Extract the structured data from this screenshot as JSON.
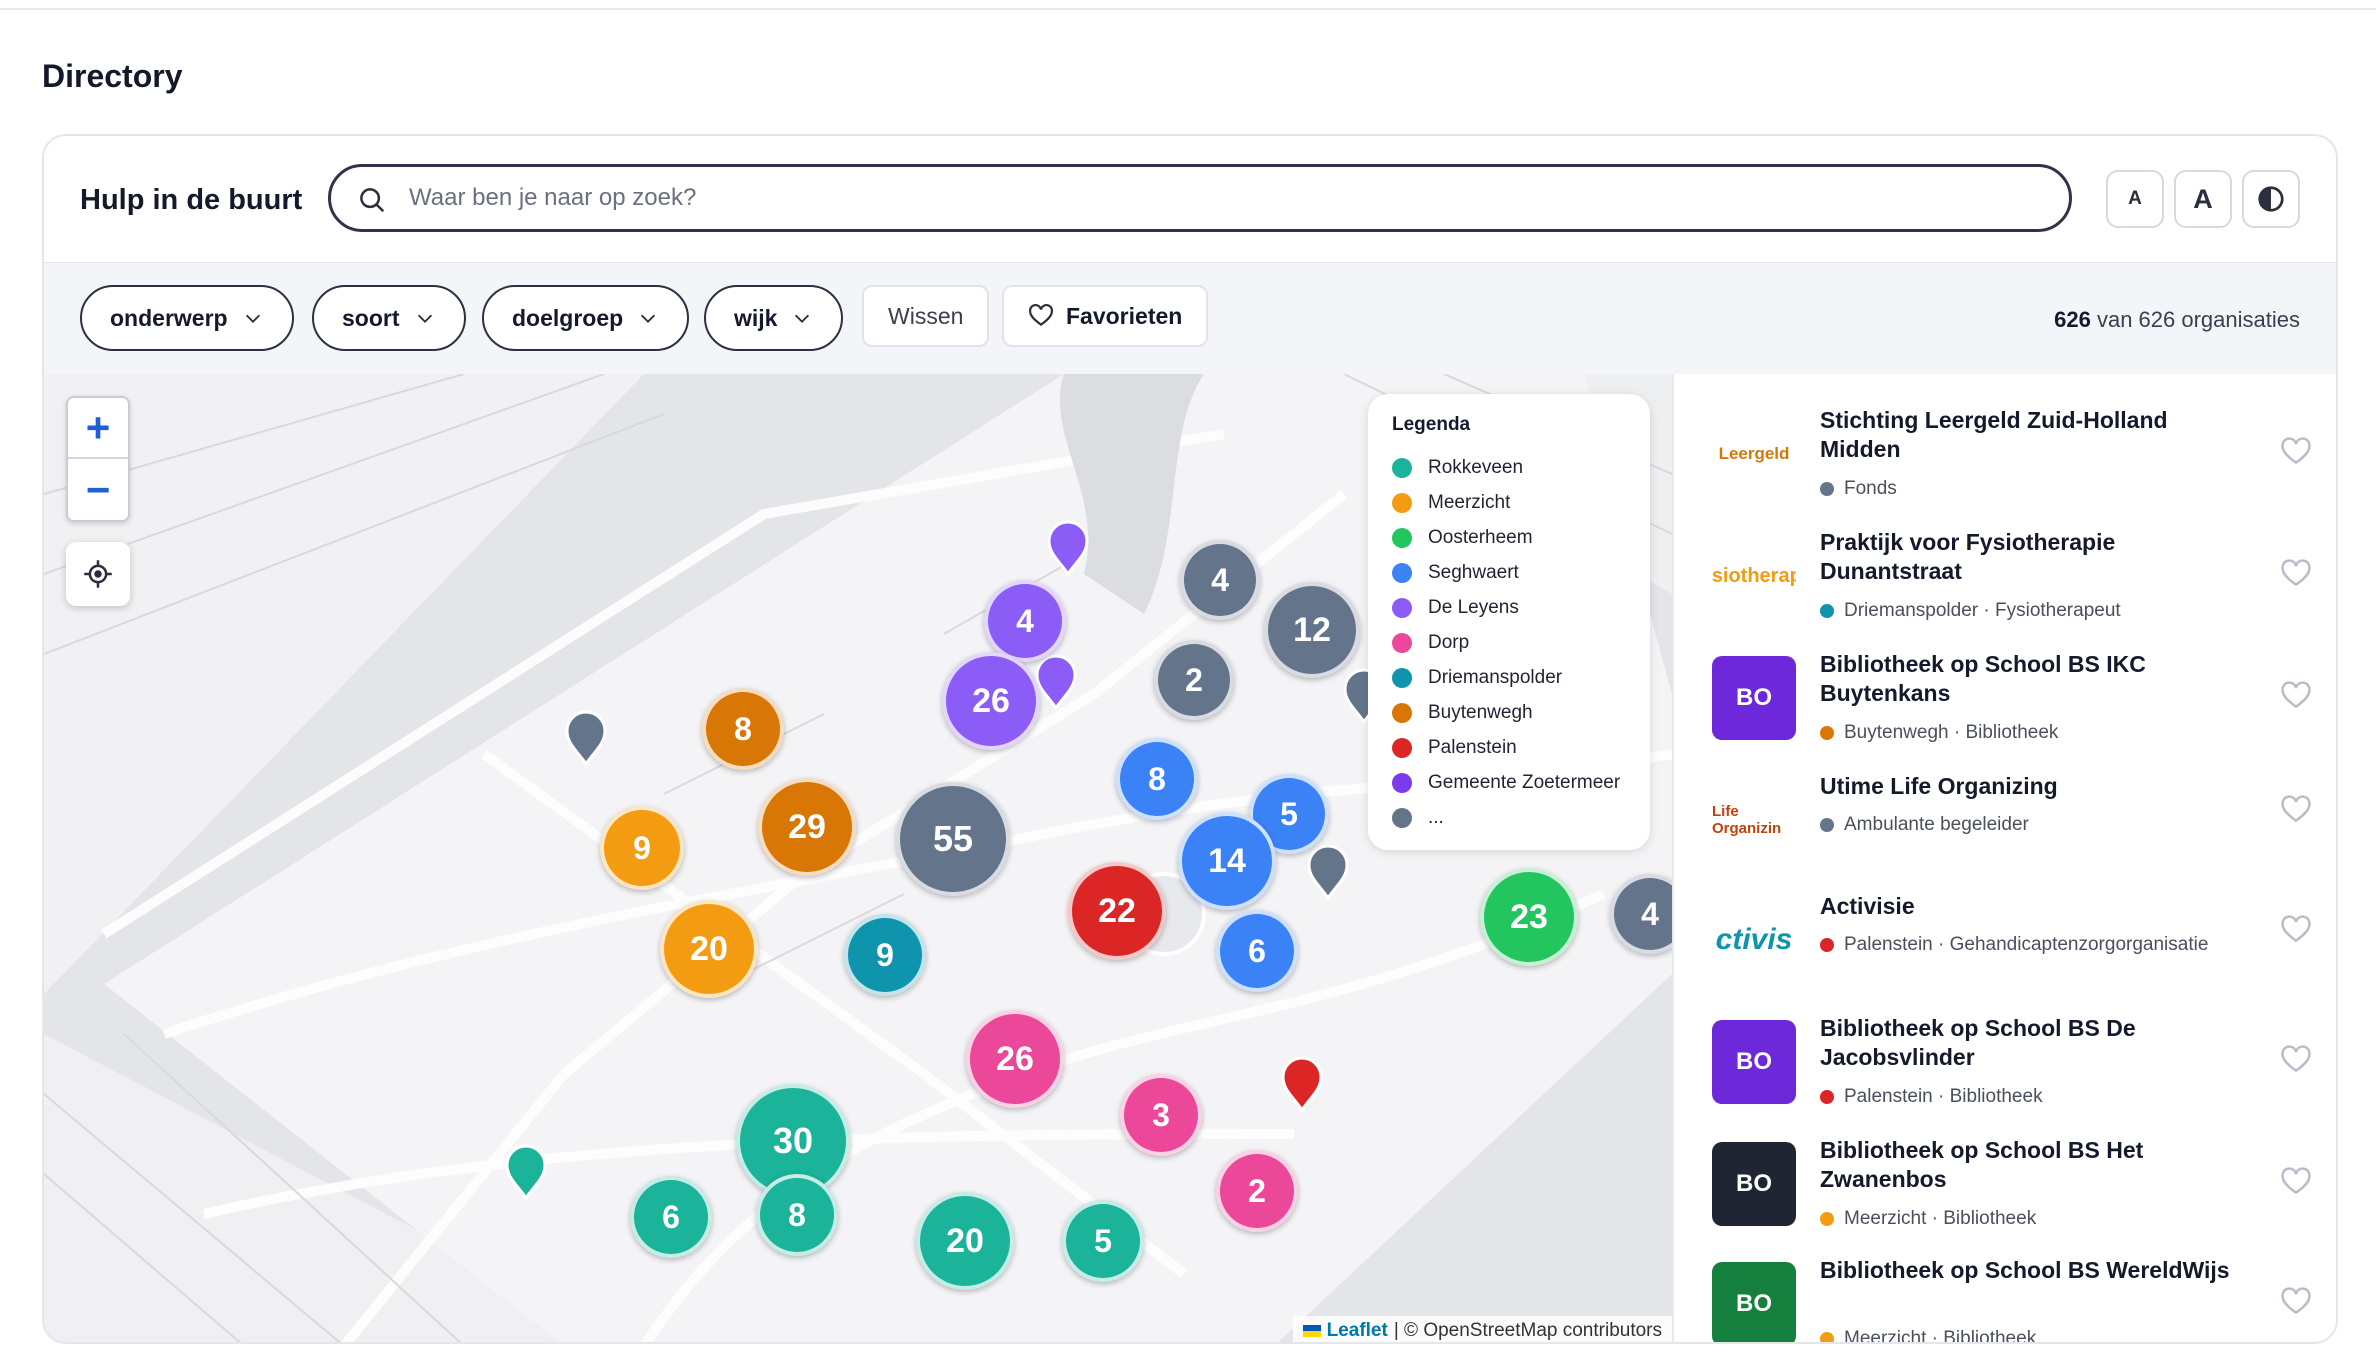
{
  "page": {
    "title": "Directory"
  },
  "header": {
    "brand": "Hulp in de buurt",
    "search_placeholder": "Waar ben je naar op zoek?",
    "font_small_label": "A",
    "font_large_label": "A"
  },
  "filters": {
    "pills": [
      "onderwerp",
      "soort",
      "doelgroep",
      "wijk"
    ],
    "clear_label": "Wissen",
    "favorites_label": "Favorieten",
    "count_bold": "626",
    "count_rest": " van 626 organisaties"
  },
  "map": {
    "legend_title": "Legenda",
    "legend": [
      {
        "label": "Rokkeveen",
        "color": "#1bb39a"
      },
      {
        "label": "Meerzicht",
        "color": "#f39c12"
      },
      {
        "label": "Oosterheem",
        "color": "#22c55e"
      },
      {
        "label": "Seghwaert",
        "color": "#3b82f6"
      },
      {
        "label": "De Leyens",
        "color": "#8b5cf6"
      },
      {
        "label": "Dorp",
        "color": "#ec4899"
      },
      {
        "label": "Driemanspolder",
        "color": "#0e94ad"
      },
      {
        "label": "Buytenwegh",
        "color": "#d97706"
      },
      {
        "label": "Palenstein",
        "color": "#dc2626"
      },
      {
        "label": "Gemeente Zoetermeer",
        "color": "#7c3aed"
      },
      {
        "label": "...",
        "color": "#64748b"
      }
    ],
    "clusters": [
      "4",
      "12",
      "2",
      "4",
      "26",
      "8",
      "29",
      "55",
      "8",
      "5",
      "14",
      "9",
      "20",
      "22",
      "9",
      "6",
      "23",
      "4",
      "26",
      "30",
      "3",
      "6",
      "8",
      "20",
      "5",
      "2"
    ],
    "attribution_leaflet": "Leaflet",
    "attribution_rest": "| © OpenStreetMap contributors"
  },
  "results": [
    {
      "name": "Stichting Leergeld Zuid-Holland Midden",
      "meta": "Fonds",
      "dot": "#64748b",
      "logo": "Leergeld"
    },
    {
      "name": "Praktijk voor Fysiotherapie Dunantstraat",
      "meta": "Driemanspolder · Fysiotherapeut",
      "dot": "#0e94ad",
      "logo": "ysiotherapi"
    },
    {
      "name": "Bibliotheek op School BS IKC Buytenkans",
      "meta": "Buytenwegh · Bibliotheek",
      "dot": "#d97706",
      "logo": "BO"
    },
    {
      "name": "Utime Life Organizing",
      "meta": "Ambulante begeleider",
      "dot": "#64748b",
      "logo": "Life Organizin"
    },
    {
      "name": "Activisie",
      "meta": "Palenstein · Gehandicaptenzorgorganisatie",
      "dot": "#dc2626",
      "logo": "ctivis"
    },
    {
      "name": "Bibliotheek op School BS De Jacobsvlinder",
      "meta": "Palenstein · Bibliotheek",
      "dot": "#dc2626",
      "logo": "BO"
    },
    {
      "name": "Bibliotheek op School BS Het Zwanenbos",
      "meta": "Meerzicht · Bibliotheek",
      "dot": "#f39c12",
      "logo": "BO"
    },
    {
      "name": "Bibliotheek op School BS WereldWijs",
      "meta": "Meerzicht · Bibliotheek",
      "dot": "#f39c12",
      "logo": "BO"
    }
  ]
}
